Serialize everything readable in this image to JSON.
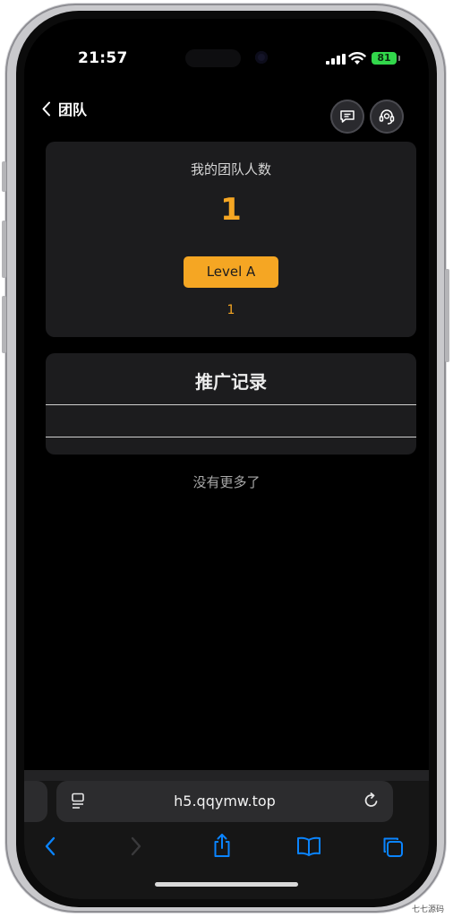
{
  "status_bar": {
    "time": "21:57",
    "battery": "81"
  },
  "nav": {
    "back_label": "团队"
  },
  "team": {
    "label": "我的团队人数",
    "count": "1",
    "level_button": "Level A",
    "level_value": "1"
  },
  "promotion": {
    "title": "推广记录"
  },
  "list_footer": "没有更多了",
  "browser": {
    "url": "h5.qqymw.top"
  },
  "watermark": "七七源码",
  "colors": {
    "accent": "#f5a623",
    "card_bg": "#1c1c1e",
    "screen_bg": "#000000",
    "ios_blue": "#0a84ff",
    "battery_green": "#32d74b"
  },
  "icons": {
    "back": "chevron-left-icon",
    "message": "message-icon",
    "support": "headset-icon",
    "reader": "reader-icon",
    "reload": "reload-icon",
    "nav_back": "chevron-left-icon",
    "nav_forward": "chevron-right-icon",
    "share": "share-icon",
    "bookmarks": "book-icon",
    "tabs": "tabs-icon"
  }
}
